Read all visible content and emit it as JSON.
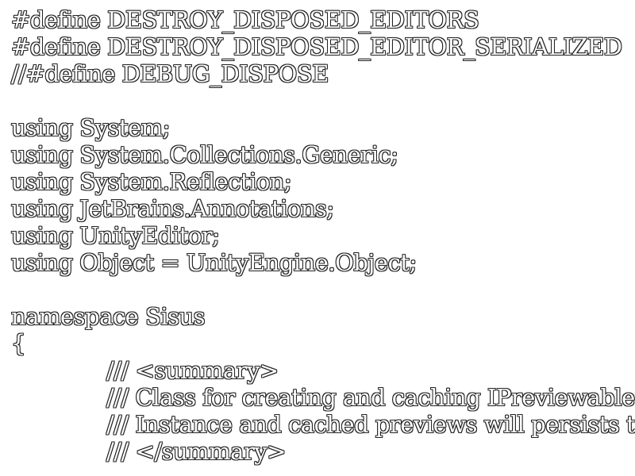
{
  "editor": {
    "lines": [
      "#define DESTROY_DISPOSED_EDITORS",
      "#define DESTROY_DISPOSED_EDITOR_SERIALIZED",
      "//#define DEBUG_DISPOSE",
      "",
      "using System;",
      "using System.Collections.Generic;",
      "using System.Reflection;",
      "using JetBrains.Annotations;",
      "using UnityEditor;",
      "using Object = UnityEngine.Object;",
      "",
      "namespace Sisus",
      "{",
      "/// <summary>",
      "/// Class for creating and caching IPreviewable",
      "/// Instance and cached previews will persists t",
      "/// </summary>"
    ]
  }
}
